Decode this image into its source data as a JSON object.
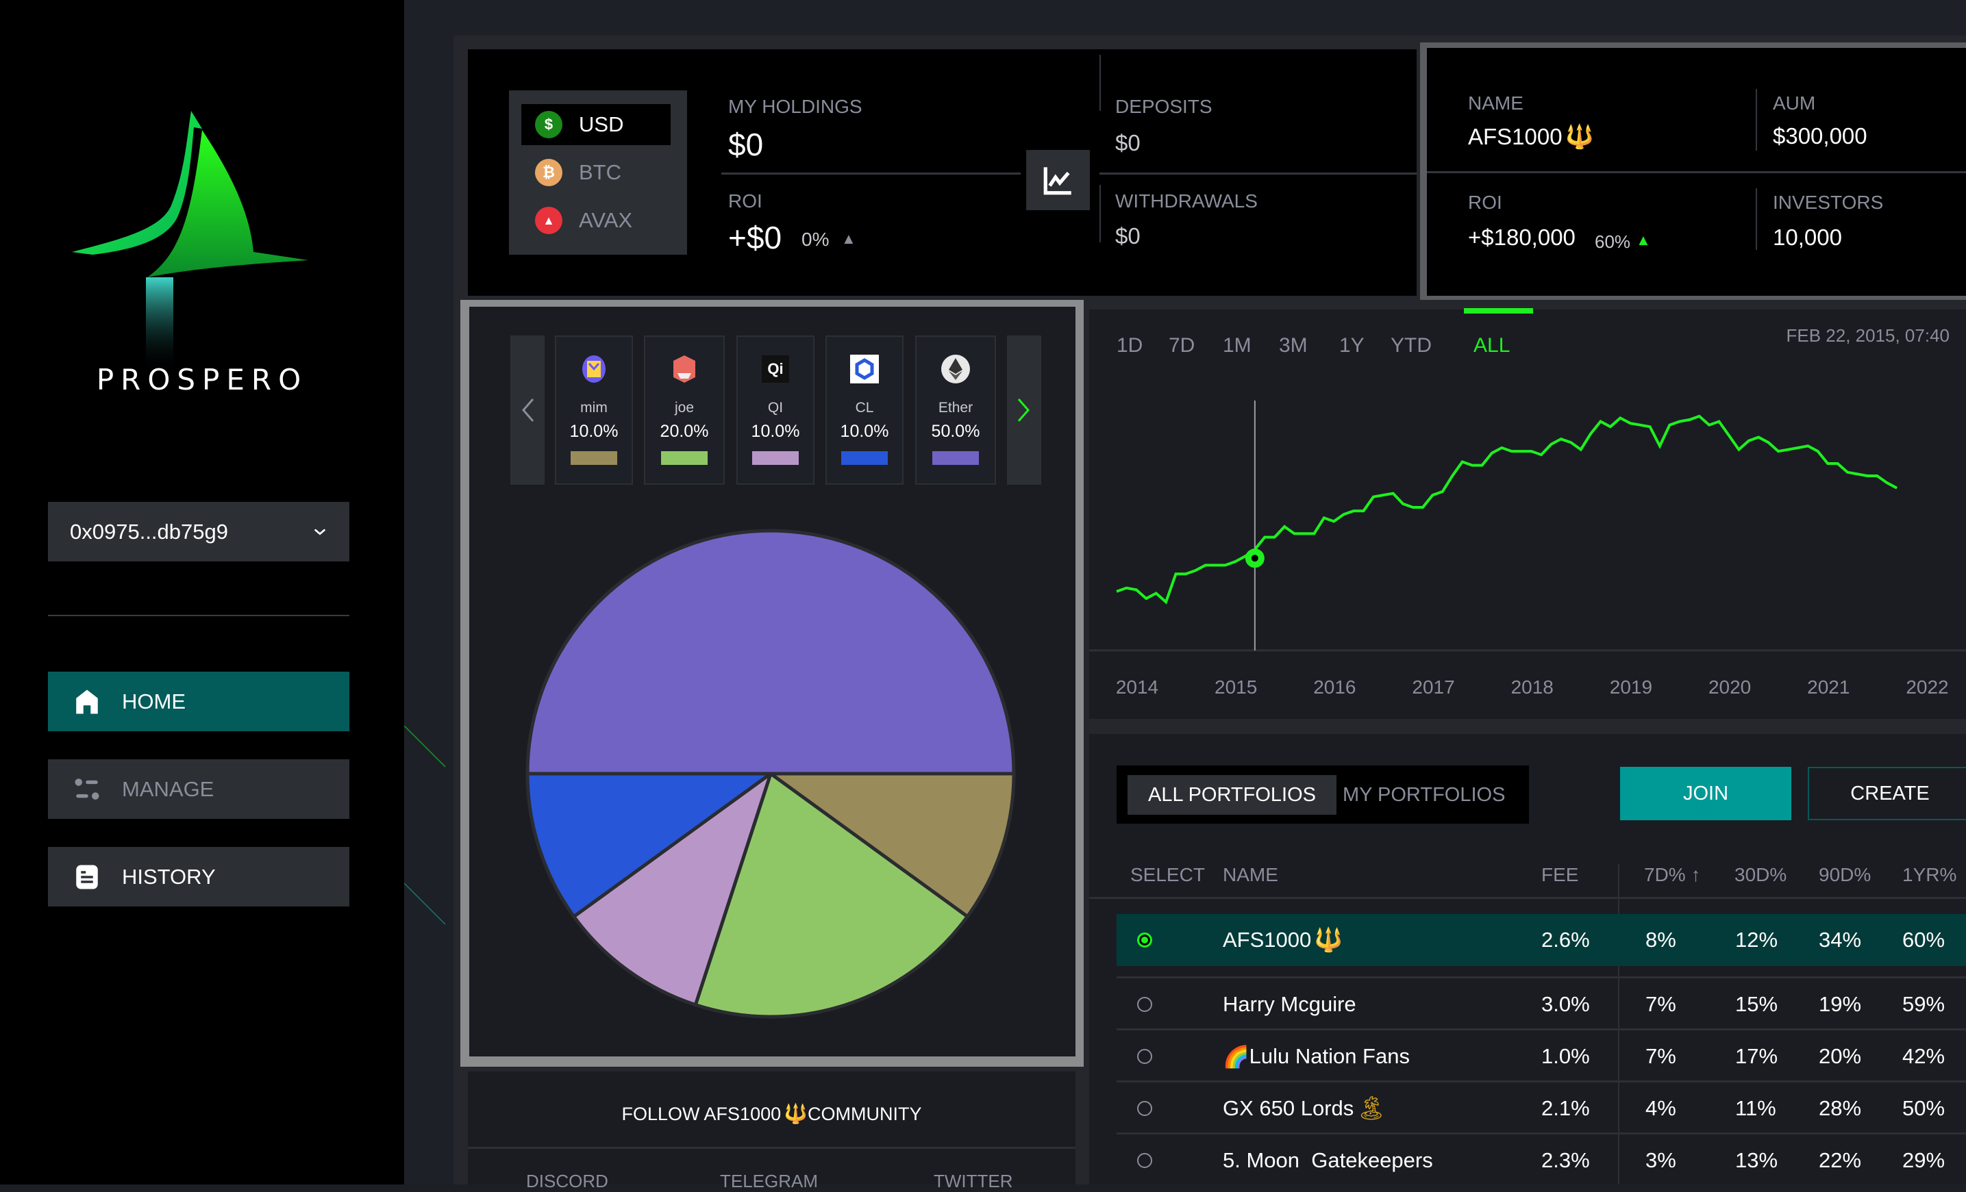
{
  "sidebar": {
    "brand": "PROSPERO",
    "wallet": {
      "address": "0x0975...db75g9"
    },
    "nav": [
      {
        "label": "HOME",
        "icon": "home-icon",
        "active": true
      },
      {
        "label": "MANAGE",
        "icon": "sliders-icon",
        "active": false
      },
      {
        "label": "HISTORY",
        "icon": "document-icon",
        "active": false
      }
    ]
  },
  "holdings": {
    "currencies": [
      {
        "label": "USD",
        "icon": "dollar-coin-icon",
        "symbol": "$",
        "color": "#1a8a1a",
        "active": true
      },
      {
        "label": "BTC",
        "icon": "bitcoin-icon",
        "symbol": "₿",
        "color": "#e9a765",
        "active": false
      },
      {
        "label": "AVAX",
        "icon": "avax-icon",
        "symbol": "▲",
        "color": "#e8323c",
        "active": false
      }
    ],
    "my_holdings_label": "MY HOLDINGS",
    "my_holdings_value": "$0",
    "roi_label": "ROI",
    "roi_value": "+$0",
    "roi_pct": "0%",
    "deposits_label": "DEPOSITS",
    "deposits_value": "$0",
    "withdrawals_label": "WITHDRAWALS",
    "withdrawals_value": "$0"
  },
  "portfolio_stats": {
    "name_label": "NAME",
    "name_value": "AFS1000",
    "name_emoji": "🔱",
    "aum_label": "AUM",
    "aum_value": "$300,000",
    "roi_label": "ROI",
    "roi_value": "+$180,000",
    "roi_pct": "60%",
    "investors_label": "INVESTORS",
    "investors_value": "10,000"
  },
  "allocation": {
    "items": [
      {
        "name": "mim",
        "pct": "10.0%",
        "color": "#998c5a",
        "icon": "mim-token-icon"
      },
      {
        "name": "joe",
        "pct": "20.0%",
        "color": "#8fc766",
        "icon": "joe-token-icon"
      },
      {
        "name": "QI",
        "pct": "10.0%",
        "color": "#b996c8",
        "icon": "qi-token-icon"
      },
      {
        "name": "CL",
        "pct": "10.0%",
        "color": "#2756d8",
        "icon": "chainlink-icon"
      },
      {
        "name": "Ether",
        "pct": "50.0%",
        "color": "#7163c4",
        "icon": "ethereum-icon"
      }
    ]
  },
  "community": {
    "title_prefix": "FOLLOW AFS1000",
    "title_emoji": "🔱",
    "title_suffix": "COMMUNITY",
    "links": [
      "DISCORD",
      "TELEGRAM",
      "TWITTER"
    ]
  },
  "chart": {
    "ranges": [
      "1D",
      "7D",
      "1M",
      "3M",
      "1Y",
      "YTD",
      "ALL"
    ],
    "active_range": "ALL",
    "hover_date": "FEB 22, 2015, 07:40"
  },
  "portfolios": {
    "tabs": [
      "ALL PORTFOLIOS",
      "MY PORTFOLIOS"
    ],
    "active_tab": "ALL PORTFOLIOS",
    "join_label": "JOIN",
    "create_label": "CREATE",
    "columns": [
      "SELECT",
      "NAME",
      "FEE",
      "7D% ↑",
      "30D%",
      "90D%",
      "1YR%"
    ],
    "rows": [
      {
        "name": "AFS1000",
        "prefix": "",
        "suffix": "🔱",
        "fee": "2.6%",
        "d7": "8%",
        "d30": "12%",
        "d90": "34%",
        "y1": "60%",
        "selected": true
      },
      {
        "name": "Harry Mcguire",
        "prefix": "",
        "suffix": "",
        "fee": "3.0%",
        "d7": "7%",
        "d30": "15%",
        "d90": "19%",
        "y1": "59%",
        "selected": false
      },
      {
        "name": "Lulu Nation Fans",
        "prefix": "🌈",
        "suffix": "",
        "fee": "1.0%",
        "d7": "7%",
        "d30": "17%",
        "d90": "20%",
        "y1": "42%",
        "selected": false
      },
      {
        "name": "GX 650 Lords",
        "prefix": "",
        "suffix": "🏝",
        "fee": "2.1%",
        "d7": "4%",
        "d30": "11%",
        "d90": "28%",
        "y1": "50%",
        "selected": false
      },
      {
        "name": "5. Moon  Gatekeepers",
        "prefix": "",
        "suffix": "",
        "fee": "2.3%",
        "d7": "3%",
        "d30": "13%",
        "d90": "22%",
        "y1": "29%",
        "selected": false
      }
    ]
  },
  "chart_data": [
    {
      "type": "line",
      "title": "",
      "xlabel": "",
      "ylabel": "",
      "x_ticks": [
        "2014",
        "2015",
        "2016",
        "2017",
        "2018",
        "2019",
        "2020",
        "2021",
        "2022"
      ],
      "xlim": [
        2013.8,
        2022.4
      ],
      "ylim": [
        0,
        100
      ],
      "grid": false,
      "series": [
        {
          "name": "AFS1000",
          "color": "#1ef01e",
          "x": [
            2013.8,
            2013.9,
            2014.0,
            2014.1,
            2014.2,
            2014.3,
            2014.4,
            2014.5,
            2014.6,
            2014.7,
            2014.8,
            2014.9,
            2015.0,
            2015.1,
            2015.2,
            2015.3,
            2015.4,
            2015.5,
            2015.6,
            2015.7,
            2015.8,
            2015.9,
            2016.0,
            2016.1,
            2016.2,
            2016.3,
            2016.4,
            2016.5,
            2016.6,
            2016.7,
            2016.8,
            2016.9,
            2017.0,
            2017.1,
            2017.2,
            2017.3,
            2017.4,
            2017.5,
            2017.6,
            2017.7,
            2017.8,
            2017.9,
            2018.0,
            2018.1,
            2018.2,
            2018.3,
            2018.4,
            2018.5,
            2018.6,
            2018.7,
            2018.8,
            2018.9,
            2019.0,
            2019.1,
            2019.2,
            2019.3,
            2019.4,
            2019.5,
            2019.6,
            2019.7,
            2019.8,
            2019.9,
            2020.0,
            2020.1,
            2020.2,
            2020.3,
            2020.4,
            2020.5,
            2020.6,
            2020.7,
            2020.8,
            2020.9,
            2021.0,
            2021.1,
            2021.2,
            2021.3,
            2021.4,
            2021.5,
            2021.6,
            2021.7,
            2021.8,
            2021.9,
            2022.0,
            2022.1,
            2022.2,
            2022.3,
            2022.4
          ],
          "y": [
            18,
            20,
            19,
            14,
            17,
            12,
            28,
            28,
            30,
            33,
            33,
            33,
            35,
            38,
            42,
            49,
            49,
            55,
            51,
            51,
            51,
            60,
            58,
            62,
            64,
            64,
            72,
            73,
            74,
            68,
            66,
            66,
            73,
            75,
            84,
            92,
            90,
            90,
            97,
            100,
            98,
            98,
            98,
            96,
            102,
            105,
            103,
            99,
            108,
            115,
            112,
            117,
            114,
            113,
            112,
            101,
            113,
            115,
            116,
            118,
            113,
            115,
            107,
            99,
            104,
            106,
            103,
            98,
            99,
            100,
            101,
            98,
            91,
            91,
            86,
            85,
            84,
            84,
            80,
            77
          ]
        }
      ],
      "hover": {
        "x": 2015.2,
        "y": 37,
        "label": "FEB 22, 2015, 07:40"
      }
    },
    {
      "type": "pie",
      "title": "",
      "categories": [
        "mim",
        "joe",
        "QI",
        "CL",
        "Ether"
      ],
      "values": [
        10.0,
        20.0,
        10.0,
        10.0,
        50.0
      ],
      "colors": [
        "#998c5a",
        "#8fc766",
        "#b996c8",
        "#2756d8",
        "#7163c4"
      ],
      "start": "3-o'clock",
      "direction": "clockwise"
    }
  ]
}
